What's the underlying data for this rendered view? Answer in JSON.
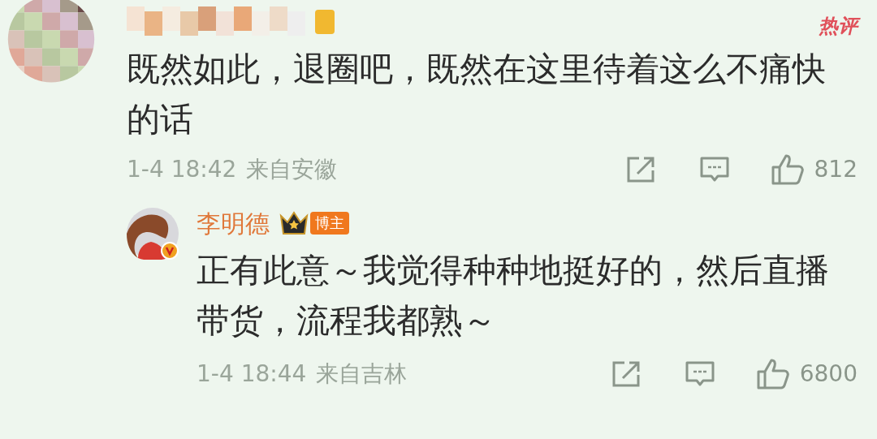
{
  "comment": {
    "hot_badge": "热评",
    "text": "既然如此，退圈吧，既然在这里待着这么不痛快的话",
    "time": "1-4 18:42",
    "location": "来自安徽",
    "likes": "812"
  },
  "reply": {
    "author": "李明德",
    "verified": true,
    "role_badge": "博主",
    "text": "正有此意～我觉得种种地挺好的，然后直播带货，流程我都熟～",
    "time": "1-4 18:44",
    "location": "来自吉林",
    "likes": "6800"
  }
}
